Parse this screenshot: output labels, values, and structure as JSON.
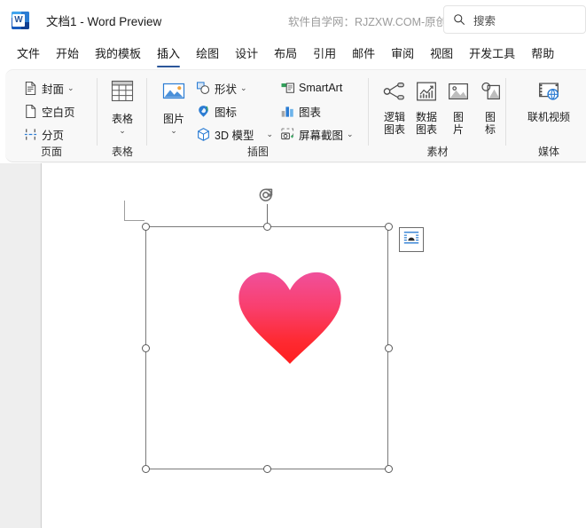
{
  "titlebar": {
    "app_icon": "word-icon",
    "document_title": "文档1  -  Word Preview",
    "watermark": "软件自学网：RJZXW.COM-原创",
    "search": {
      "icon": "search-icon",
      "placeholder": "搜索",
      "value": "搜索"
    }
  },
  "tabs": [
    {
      "label": "文件",
      "active": false
    },
    {
      "label": "开始",
      "active": false
    },
    {
      "label": "我的模板",
      "active": false
    },
    {
      "label": "插入",
      "active": true
    },
    {
      "label": "绘图",
      "active": false
    },
    {
      "label": "设计",
      "active": false
    },
    {
      "label": "布局",
      "active": false
    },
    {
      "label": "引用",
      "active": false
    },
    {
      "label": "邮件",
      "active": false
    },
    {
      "label": "审阅",
      "active": false
    },
    {
      "label": "视图",
      "active": false
    },
    {
      "label": "开发工具",
      "active": false
    },
    {
      "label": "帮助",
      "active": false
    }
  ],
  "ribbon": {
    "groups": [
      {
        "name": "页面",
        "label": "页面",
        "items": [
          {
            "label": "封面",
            "icon": "cover-page-icon",
            "has_dropdown": true
          },
          {
            "label": "空白页",
            "icon": "blank-page-icon",
            "has_dropdown": false
          },
          {
            "label": "分页",
            "icon": "page-break-icon",
            "has_dropdown": false
          }
        ]
      },
      {
        "name": "表格",
        "label": "表格",
        "items": [
          {
            "label": "表格",
            "icon": "table-icon",
            "has_dropdown": true
          }
        ]
      },
      {
        "name": "插图",
        "label": "插图",
        "items": [
          {
            "label": "图片",
            "icon": "picture-icon",
            "has_dropdown": true
          },
          {
            "label": "形状",
            "icon": "shapes-icon",
            "has_dropdown": true
          },
          {
            "label": "图标",
            "icon": "icons-icon",
            "has_dropdown": false
          },
          {
            "label": "3D 模型",
            "icon": "3d-model-icon",
            "has_dropdown": true
          },
          {
            "label": "SmartArt",
            "icon": "smartart-icon",
            "has_dropdown": false
          },
          {
            "label": "图表",
            "icon": "chart-icon",
            "has_dropdown": false
          },
          {
            "label": "屏幕截图",
            "icon": "screenshot-icon",
            "has_dropdown": true
          }
        ]
      },
      {
        "name": "素材",
        "label": "素材",
        "items": [
          {
            "label": "逻辑\n图表",
            "line1": "逻辑",
            "line2": "图表",
            "icon": "logic-diagram-icon"
          },
          {
            "label": "数据\n图表",
            "line1": "数据",
            "line2": "图表",
            "icon": "data-chart-icon"
          },
          {
            "label": "图\n片",
            "line1": "图",
            "line2": "片",
            "icon": "material-picture-icon"
          },
          {
            "label": "图\n标",
            "line1": "图",
            "line2": "标",
            "icon": "material-icon-icon"
          }
        ]
      },
      {
        "name": "媒体",
        "label": "媒体",
        "items": [
          {
            "label": "联机视频",
            "icon": "online-video-icon"
          }
        ]
      }
    ]
  },
  "document": {
    "selected_object": {
      "type": "heart-image",
      "name": "heart-shape",
      "gradient_top": "#F04A94",
      "gradient_bottom": "#FF1F1F",
      "handles": [
        "top-left",
        "top-center",
        "top-right",
        "middle-left",
        "middle-right",
        "bottom-left",
        "bottom-center",
        "bottom-right"
      ],
      "rotation_handle": "rotate-handle",
      "layout_options_icon": "layout-options-icon"
    },
    "margin_marker": "page-margin-corner"
  },
  "colors": {
    "accent": "#2b579a",
    "page_bg": "#ffffff",
    "canvas_bg": "#eeeeee",
    "ribbon_bg": "#f8f8f8"
  }
}
